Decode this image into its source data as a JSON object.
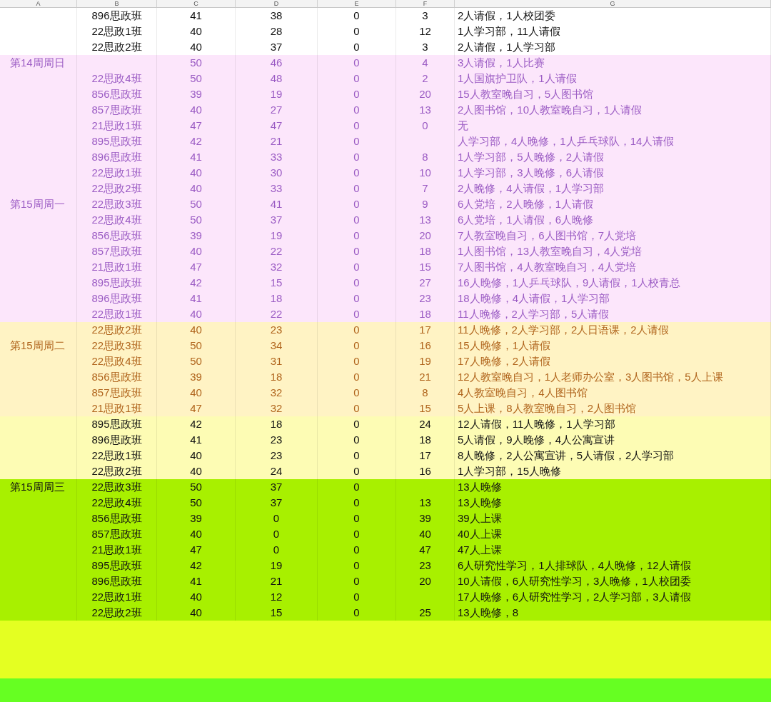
{
  "columns": [
    "A",
    "B",
    "C",
    "D",
    "E",
    "F",
    "G"
  ],
  "groups": [
    {
      "color": "#ffffff",
      "kind": "plain",
      "rows": [
        {
          "cells": [
            "896思政班",
            "41",
            "38",
            "0",
            "3",
            "2人请假，1人校团委"
          ]
        },
        {
          "cells": [
            "22思政1班",
            "40",
            "28",
            "0",
            "12",
            "1人学习部，11人请假"
          ]
        },
        {
          "cells": [
            "22思政2班",
            "40",
            "37",
            "0",
            "3",
            "2人请假，1人学习部"
          ]
        }
      ]
    },
    {
      "color": "#fce6fb",
      "kind": "violet",
      "rows": [
        {
          "label": "第14周周日",
          "cells": [
            "",
            "50",
            "46",
            "0",
            "4",
            "3人请假，1人比赛"
          ]
        },
        {
          "cells": [
            "22思政4班",
            "50",
            "48",
            "0",
            "2",
            "1人国旗护卫队，1人请假"
          ]
        },
        {
          "cells": [
            "856思政班",
            "39",
            "19",
            "0",
            "20",
            "15人教室晚自习，5人图书馆"
          ]
        },
        {
          "cells": [
            "857思政班",
            "40",
            "27",
            "0",
            "13",
            "2人图书馆，10人教室晚自习，1人请假"
          ]
        },
        {
          "cells": [
            "21思政1班",
            "47",
            "47",
            "0",
            "0",
            "无"
          ]
        },
        {
          "cells": [
            "895思政班",
            "42",
            "21",
            "0",
            "",
            "人学习部，4人晚修，1人乒乓球队，14人请假"
          ]
        },
        {
          "cells": [
            "896思政班",
            "41",
            "33",
            "0",
            "8",
            "1人学习部，5人晚修，2人请假"
          ]
        },
        {
          "cells": [
            "22思政1班",
            "40",
            "30",
            "0",
            "10",
            "1人学习部，3人晚修，6人请假"
          ]
        },
        {
          "cells": [
            "22思政2班",
            "40",
            "33",
            "0",
            "7",
            "2人晚修，4人请假，1人学习部"
          ]
        },
        {
          "label": "第15周周一",
          "cells": [
            "22思政3班",
            "50",
            "41",
            "0",
            "9",
            "6人党培，2人晚修，1人请假"
          ]
        },
        {
          "cells": [
            "22思政4班",
            "50",
            "37",
            "0",
            "13",
            "6人党培，1人请假，6人晚修"
          ]
        },
        {
          "cells": [
            "856思政班",
            "39",
            "19",
            "0",
            "20",
            "7人教室晚自习，6人图书馆，7人党培"
          ]
        },
        {
          "cells": [
            "857思政班",
            "40",
            "22",
            "0",
            "18",
            "1人图书馆，13人教室晚自习，4人党培"
          ]
        },
        {
          "cells": [
            "21思政1班",
            "47",
            "32",
            "0",
            "15",
            "7人图书馆，4人教室晚自习，4人党培"
          ]
        },
        {
          "cells": [
            "895思政班",
            "42",
            "15",
            "0",
            "27",
            "16人晚修，1人乒乓球队，9人请假，1人校青总"
          ]
        },
        {
          "cells": [
            "896思政班",
            "41",
            "18",
            "0",
            "23",
            "18人晚修，4人请假，1人学习部"
          ]
        },
        {
          "cells": [
            "22思政1班",
            "40",
            "22",
            "0",
            "18",
            "11人晚修，2人学习部，5人请假"
          ]
        }
      ]
    },
    {
      "color": "#fff3c4",
      "kind": "amber",
      "rows": [
        {
          "cells": [
            "22思政2班",
            "40",
            "23",
            "0",
            "17",
            "11人晚修，2人学习部，2人日语课，2人请假"
          ]
        },
        {
          "label": "第15周周二",
          "cells": [
            "22思政3班",
            "50",
            "34",
            "0",
            "16",
            "15人晚修，1人请假"
          ]
        },
        {
          "cells": [
            "22思政4班",
            "50",
            "31",
            "0",
            "19",
            "17人晚修，2人请假"
          ]
        },
        {
          "cells": [
            "856思政班",
            "39",
            "18",
            "0",
            "21",
            "12人教室晚自习，1人老师办公室，3人图书馆，5人上课"
          ]
        },
        {
          "cells": [
            "857思政班",
            "40",
            "32",
            "0",
            "8",
            "4人教室晚自习，4人图书馆"
          ]
        },
        {
          "cells": [
            "21思政1班",
            "47",
            "32",
            "0",
            "15",
            "5人上课，8人教室晚自习，2人图书馆"
          ]
        }
      ]
    },
    {
      "color": "#fdfcb4",
      "kind": "plain",
      "rows": [
        {
          "cells": [
            "895思政班",
            "42",
            "18",
            "0",
            "24",
            "12人请假，11人晚修，1人学习部"
          ]
        },
        {
          "cells": [
            "896思政班",
            "41",
            "23",
            "0",
            "18",
            "5人请假，9人晚修，4人公寓宣讲"
          ]
        },
        {
          "cells": [
            "22思政1班",
            "40",
            "23",
            "0",
            "17",
            "8人晚修，2人公寓宣讲，5人请假，2人学习部"
          ]
        },
        {
          "cells": [
            "22思政2班",
            "40",
            "24",
            "0",
            "16",
            "1人学习部，15人晚修"
          ]
        }
      ]
    },
    {
      "color": "#a8f000",
      "kind": "plain",
      "rows": [
        {
          "label": "第15周周三",
          "cells": [
            "22思政3班",
            "50",
            "37",
            "0",
            "",
            "13人晚修"
          ]
        },
        {
          "cells": [
            "22思政4班",
            "50",
            "37",
            "0",
            "13",
            "13人晚修"
          ]
        },
        {
          "cells": [
            "856思政班",
            "39",
            "0",
            "0",
            "39",
            "39人上课"
          ]
        },
        {
          "cells": [
            "857思政班",
            "40",
            "0",
            "0",
            "40",
            "40人上课"
          ]
        },
        {
          "cells": [
            "21思政1班",
            "47",
            "0",
            "0",
            "47",
            "47人上课"
          ]
        },
        {
          "cells": [
            "895思政班",
            "42",
            "19",
            "0",
            "23",
            "6人研究性学习，1人排球队，4人晚修，12人请假"
          ]
        },
        {
          "cells": [
            "896思政班",
            "41",
            "21",
            "0",
            "20",
            "10人请假，6人研究性学习，3人晚修，1人校团委"
          ]
        },
        {
          "cells": [
            "22思政1班",
            "40",
            "12",
            "0",
            "",
            "17人晚修，6人研究性学习，2人学习部，3人请假"
          ]
        },
        {
          "cells": [
            "22思政2班",
            "40",
            "15",
            "0",
            "25",
            "13人晚修，8"
          ]
        }
      ]
    }
  ]
}
